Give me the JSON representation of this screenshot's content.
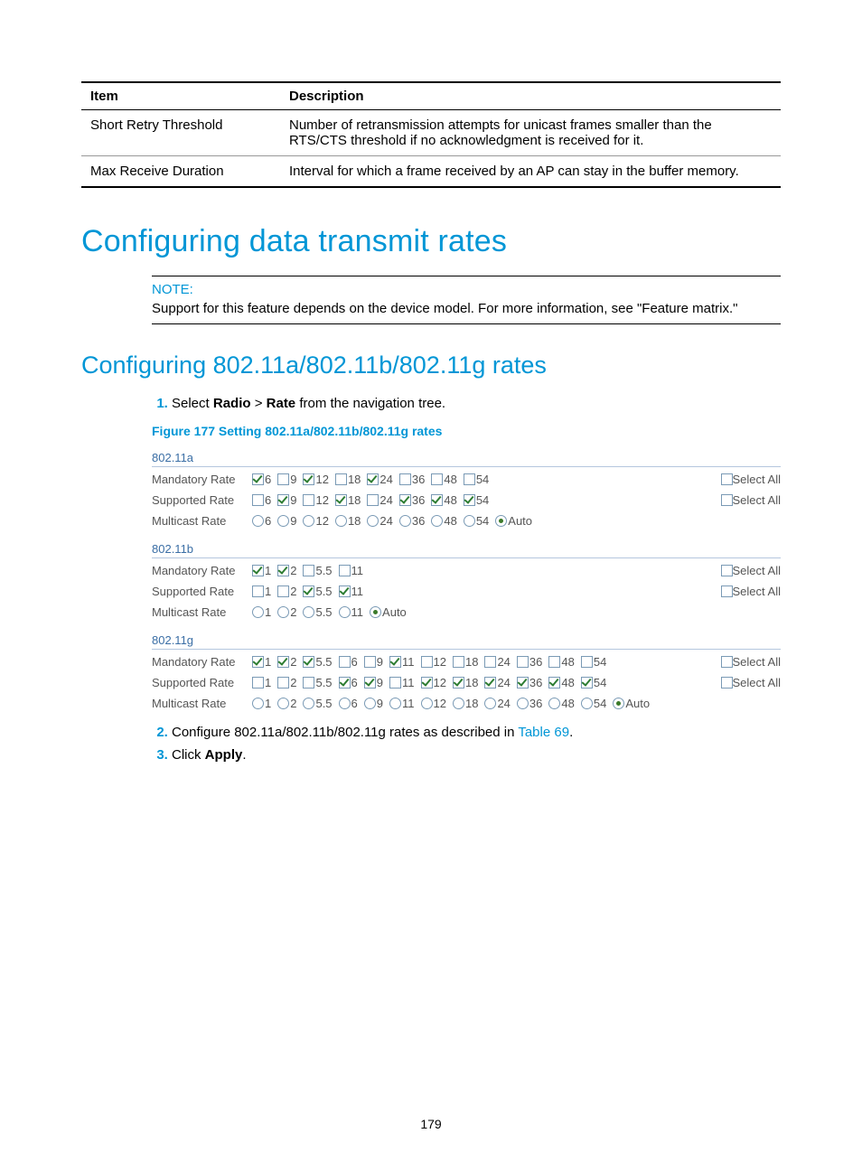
{
  "table": {
    "headers": [
      "Item",
      "Description"
    ],
    "rows": [
      {
        "item": "Short Retry Threshold",
        "desc": "Number of retransmission attempts for unicast frames smaller than the RTS/CTS threshold if no acknowledgment is received for it."
      },
      {
        "item": "Max Receive Duration",
        "desc": "Interval for which a frame received by an AP can stay in the buffer memory."
      }
    ]
  },
  "h1": "Configuring data transmit rates",
  "note": {
    "label": "NOTE:",
    "text": "Support for this feature depends on the device model. For more information, see \"Feature matrix.\""
  },
  "h2": "Configuring 802.11a/802.11b/802.11g rates",
  "steps": {
    "s1a": "Select ",
    "s1b": "Radio",
    "s1c": " > ",
    "s1d": "Rate",
    "s1e": " from the navigation tree.",
    "s2a": "Configure 802.11a/802.11b/802.11g rates as described in ",
    "s2link": "Table 69",
    "s2b": ".",
    "s3a": "Click ",
    "s3b": "Apply",
    "s3c": "."
  },
  "figcap": "Figure 177 Setting 802.11a/802.11b/802.11g rates",
  "select_all_label": "Select All",
  "labels": {
    "mandatory": "Mandatory Rate",
    "supported": "Supported Rate",
    "multicast": "Multicast Rate"
  },
  "sections": [
    {
      "title": "802.11a",
      "rows": [
        {
          "label_key": "mandatory",
          "type": "cb",
          "select_all": true,
          "opts": [
            {
              "v": "6",
              "c": true
            },
            {
              "v": "9",
              "c": false
            },
            {
              "v": "12",
              "c": true
            },
            {
              "v": "18",
              "c": false
            },
            {
              "v": "24",
              "c": true
            },
            {
              "v": "36",
              "c": false
            },
            {
              "v": "48",
              "c": false
            },
            {
              "v": "54",
              "c": false
            }
          ]
        },
        {
          "label_key": "supported",
          "type": "cb",
          "select_all": true,
          "opts": [
            {
              "v": "6",
              "c": false
            },
            {
              "v": "9",
              "c": true
            },
            {
              "v": "12",
              "c": false
            },
            {
              "v": "18",
              "c": true
            },
            {
              "v": "24",
              "c": false
            },
            {
              "v": "36",
              "c": true
            },
            {
              "v": "48",
              "c": true
            },
            {
              "v": "54",
              "c": true
            }
          ]
        },
        {
          "label_key": "multicast",
          "type": "rb",
          "select_all": false,
          "opts": [
            {
              "v": "6",
              "c": false
            },
            {
              "v": "9",
              "c": false
            },
            {
              "v": "12",
              "c": false
            },
            {
              "v": "18",
              "c": false
            },
            {
              "v": "24",
              "c": false
            },
            {
              "v": "36",
              "c": false
            },
            {
              "v": "48",
              "c": false
            },
            {
              "v": "54",
              "c": false
            },
            {
              "v": "Auto",
              "c": true
            }
          ]
        }
      ]
    },
    {
      "title": "802.11b",
      "rows": [
        {
          "label_key": "mandatory",
          "type": "cb",
          "select_all": true,
          "opts": [
            {
              "v": "1",
              "c": true
            },
            {
              "v": "2",
              "c": true
            },
            {
              "v": "5.5",
              "c": false
            },
            {
              "v": "11",
              "c": false
            }
          ]
        },
        {
          "label_key": "supported",
          "type": "cb",
          "select_all": true,
          "opts": [
            {
              "v": "1",
              "c": false
            },
            {
              "v": "2",
              "c": false
            },
            {
              "v": "5.5",
              "c": true
            },
            {
              "v": "11",
              "c": true
            }
          ]
        },
        {
          "label_key": "multicast",
          "type": "rb",
          "select_all": false,
          "opts": [
            {
              "v": "1",
              "c": false
            },
            {
              "v": "2",
              "c": false
            },
            {
              "v": "5.5",
              "c": false
            },
            {
              "v": "11",
              "c": false
            },
            {
              "v": "Auto",
              "c": true
            }
          ]
        }
      ]
    },
    {
      "title": "802.11g",
      "rows": [
        {
          "label_key": "mandatory",
          "type": "cb",
          "select_all": true,
          "opts": [
            {
              "v": "1",
              "c": true
            },
            {
              "v": "2",
              "c": true
            },
            {
              "v": "5.5",
              "c": true
            },
            {
              "v": "6",
              "c": false
            },
            {
              "v": "9",
              "c": false
            },
            {
              "v": "11",
              "c": true
            },
            {
              "v": "12",
              "c": false
            },
            {
              "v": "18",
              "c": false
            },
            {
              "v": "24",
              "c": false
            },
            {
              "v": "36",
              "c": false
            },
            {
              "v": "48",
              "c": false
            },
            {
              "v": "54",
              "c": false
            }
          ]
        },
        {
          "label_key": "supported",
          "type": "cb",
          "select_all": true,
          "opts": [
            {
              "v": "1",
              "c": false
            },
            {
              "v": "2",
              "c": false
            },
            {
              "v": "5.5",
              "c": false
            },
            {
              "v": "6",
              "c": true
            },
            {
              "v": "9",
              "c": true
            },
            {
              "v": "11",
              "c": false
            },
            {
              "v": "12",
              "c": true
            },
            {
              "v": "18",
              "c": true
            },
            {
              "v": "24",
              "c": true
            },
            {
              "v": "36",
              "c": true
            },
            {
              "v": "48",
              "c": true
            },
            {
              "v": "54",
              "c": true
            }
          ]
        },
        {
          "label_key": "multicast",
          "type": "rb",
          "select_all": false,
          "opts": [
            {
              "v": "1",
              "c": false
            },
            {
              "v": "2",
              "c": false
            },
            {
              "v": "5.5",
              "c": false
            },
            {
              "v": "6",
              "c": false
            },
            {
              "v": "9",
              "c": false
            },
            {
              "v": "11",
              "c": false
            },
            {
              "v": "12",
              "c": false
            },
            {
              "v": "18",
              "c": false
            },
            {
              "v": "24",
              "c": false
            },
            {
              "v": "36",
              "c": false
            },
            {
              "v": "48",
              "c": false
            },
            {
              "v": "54",
              "c": false
            },
            {
              "v": "Auto",
              "c": true
            }
          ]
        }
      ]
    }
  ],
  "pagenum": "179"
}
